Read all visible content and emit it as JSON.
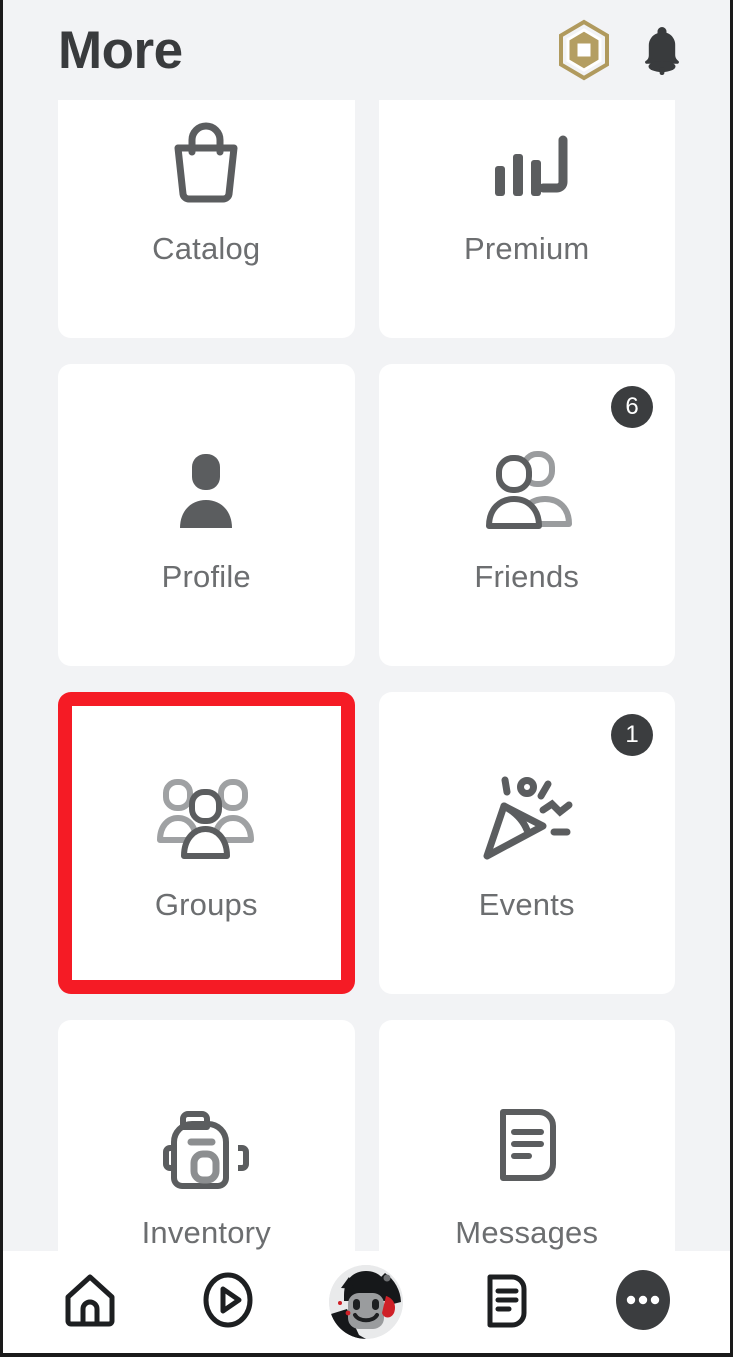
{
  "header": {
    "title": "More",
    "robux_icon": "robux-hexagon-icon",
    "notification_icon": "bell-icon"
  },
  "grid": {
    "cards": [
      {
        "label": "Catalog",
        "icon": "shopping-bag-icon",
        "badge": null,
        "highlighted": false
      },
      {
        "label": "Premium",
        "icon": "premium-bars-icon",
        "badge": null,
        "highlighted": false
      },
      {
        "label": "Profile",
        "icon": "person-filled-icon",
        "badge": null,
        "highlighted": false
      },
      {
        "label": "Friends",
        "icon": "two-people-icon",
        "badge": "6",
        "highlighted": false
      },
      {
        "label": "Groups",
        "icon": "three-people-icon",
        "badge": null,
        "highlighted": true
      },
      {
        "label": "Events",
        "icon": "party-popper-icon",
        "badge": "1",
        "highlighted": false
      },
      {
        "label": "Inventory",
        "icon": "backpack-icon",
        "badge": null,
        "highlighted": false
      },
      {
        "label": "Messages",
        "icon": "message-page-icon",
        "badge": null,
        "highlighted": false
      }
    ]
  },
  "bottom_nav": {
    "items": [
      {
        "name": "home",
        "icon": "home-icon"
      },
      {
        "name": "charts",
        "icon": "play-circle-icon"
      },
      {
        "name": "avatar",
        "icon": "avatar-headshot-icon"
      },
      {
        "name": "chat",
        "icon": "chat-page-icon"
      },
      {
        "name": "more",
        "icon": "ellipsis-circle-icon"
      }
    ]
  },
  "colors": {
    "background": "#f2f3f5",
    "card": "#ffffff",
    "label_text": "#6c6e70",
    "title_text": "#393b3d",
    "highlight": "#f51b25",
    "badge_bg": "#3b3d3f",
    "robux_gold": "#b09a5e"
  }
}
